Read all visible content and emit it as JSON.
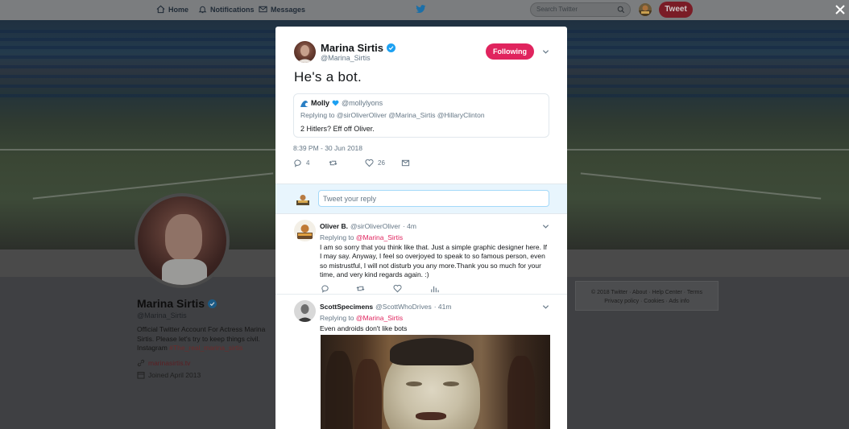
{
  "nav": {
    "home": "Home",
    "notifications": "Notifications",
    "messages": "Messages",
    "search_placeholder": "Search Twitter",
    "tweet_button": "Tweet"
  },
  "profile": {
    "name": "Marina Sirtis",
    "handle": "@Marina_Sirtis",
    "bio": "Official Twitter Account For Actress Marina Sirtis. Please let's try to keep things civil. Instagram",
    "hashtag": "#The_real_marina_sirtis",
    "website": "marinasirtis.tv",
    "joined": "Joined April 2013"
  },
  "footer": {
    "line1": "© 2018 Twitter · About · Help Center · Terms",
    "line2": "Privacy policy · Cookies · Ads info"
  },
  "tweet": {
    "author_name": "Marina Sirtis",
    "author_handle": "@Marina_Sirtis",
    "follow_label": "Following",
    "text": "He's a bot.",
    "timestamp": "8:39 PM - 30 Jun 2018",
    "reply_count": "4",
    "like_count": "26",
    "quoted": {
      "name": "Molly",
      "handle": "@mollylyons",
      "replying_prefix": "Replying to",
      "replying_to": "@sirOliverOliver @Marina_Sirtis @HillaryClinton",
      "text": "2 Hitlers? Eff off Oliver."
    }
  },
  "reply_box": {
    "placeholder": "Tweet your reply"
  },
  "replies": [
    {
      "name": "Oliver B.",
      "handle": "@sirOliverOliver",
      "time": "· 4m",
      "replying_prefix": "Replying to",
      "replying_to": "@Marina_Sirtis",
      "text": "I am so sorry that you think like that. Just a simple graphic designer here. If I may say. Anyway, I feel so overjoyed to speak to so famous person, even so mistrustful, I will not disturb you any more.Thank you so much for your time, and very kind regards again. :)"
    },
    {
      "name": "ScottSpecimens",
      "handle": "@ScottWhoDrives",
      "time": "· 41m",
      "replying_prefix": "Replying to",
      "replying_to": "@Marina_Sirtis",
      "text": "Even androids don't like bots"
    }
  ],
  "colors": {
    "accent_red": "#e0245e",
    "twitter_blue": "#1da1f2",
    "reply_bar_bg": "#e8f5fd"
  }
}
